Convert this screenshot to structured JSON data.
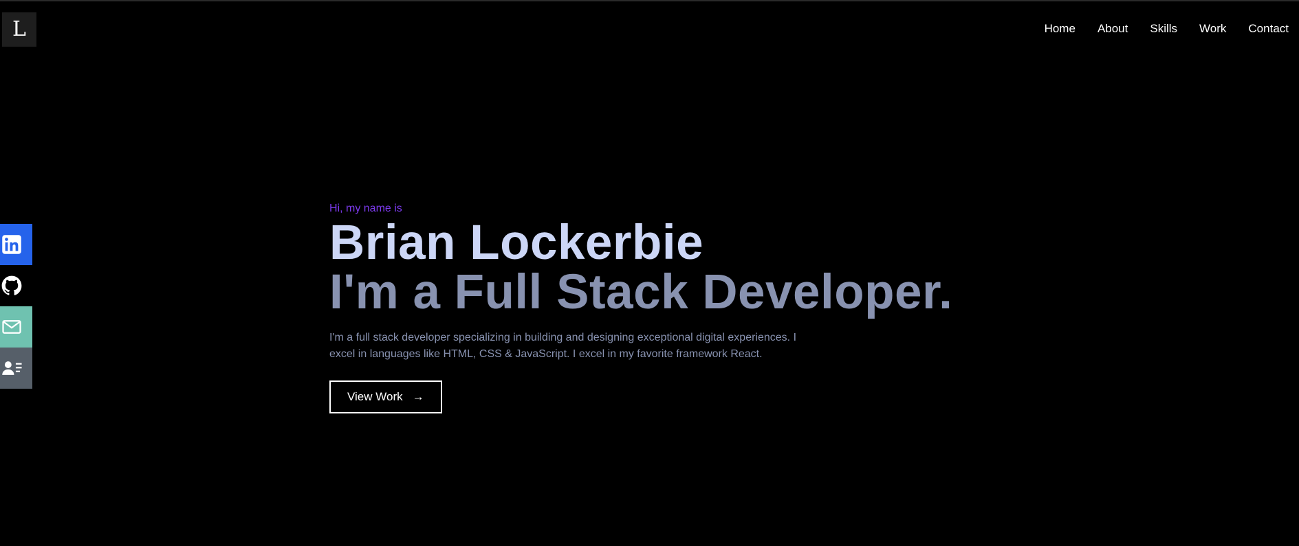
{
  "logo": {
    "letter": "L"
  },
  "nav": {
    "items": [
      {
        "label": "Home"
      },
      {
        "label": "About"
      },
      {
        "label": "Skills"
      },
      {
        "label": "Work"
      },
      {
        "label": "Contact"
      }
    ]
  },
  "social": {
    "items": [
      {
        "icon": "linkedin-icon",
        "color": "#2563eb"
      },
      {
        "icon": "github-icon",
        "color": "#000000"
      },
      {
        "icon": "mail-icon",
        "color": "#6fc2b0"
      },
      {
        "icon": "contact-card-icon",
        "color": "#565f69"
      }
    ]
  },
  "hero": {
    "greeting": "Hi, my name is",
    "name": "Brian Lockerbie",
    "title": "I'm a Full Stack Developer.",
    "description": "I'm a full stack developer specializing in building and designing exceptional digital experiences. I excel in languages like HTML, CSS & JavaScript. I excel in my favorite framework React.",
    "button_label": "View Work",
    "button_arrow": "→"
  },
  "colors": {
    "background": "#000000",
    "accent": "#7c3aed",
    "name": "#ccd6f6",
    "muted": "#8892b0"
  }
}
